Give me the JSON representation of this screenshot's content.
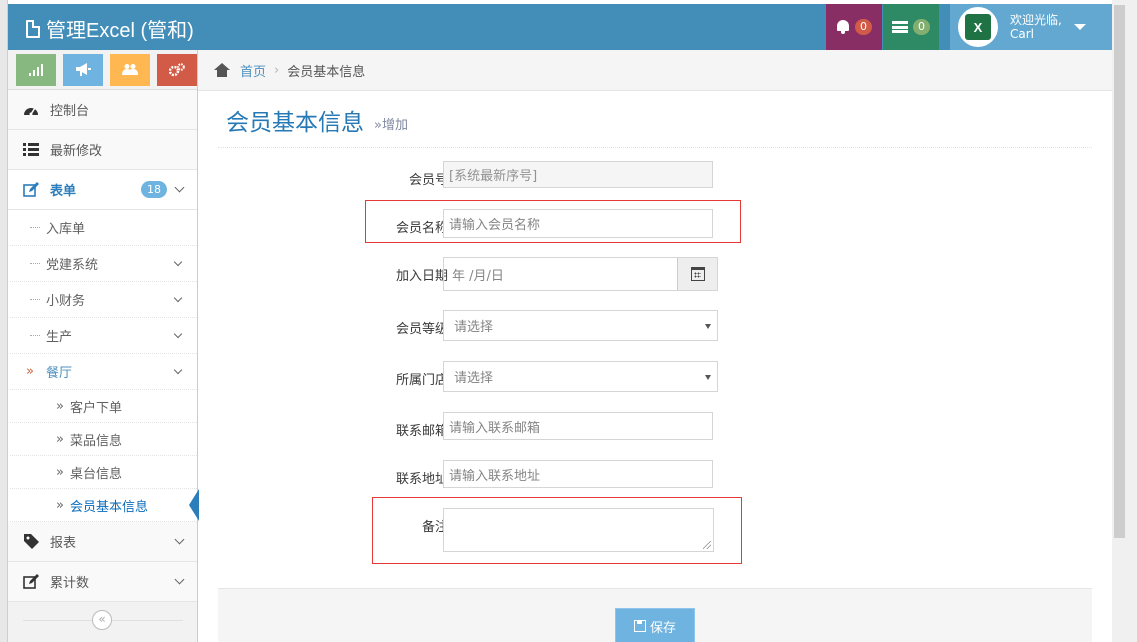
{
  "app": {
    "title": "管理Excel (管和)"
  },
  "navbar": {
    "notifications_count": "0",
    "tasks_count": "0",
    "user_greeting": "欢迎光临,",
    "user_name": "Carl",
    "avatar_label": "X"
  },
  "sidebar": {
    "items": [
      {
        "label": "控制台",
        "icon": "dashboard-icon"
      },
      {
        "label": "最新修改",
        "icon": "list-icon"
      },
      {
        "label": "表单",
        "icon": "edit-icon",
        "badge": "18"
      }
    ],
    "form_sub": [
      "入库单",
      "党建系统",
      "小财务",
      "生产",
      "餐厅"
    ],
    "restaurant_sub": [
      "客户下单",
      "菜品信息",
      "桌台信息",
      "会员基本信息"
    ],
    "bottom_items": [
      {
        "label": "报表",
        "icon": "tag-icon"
      },
      {
        "label": "累计数",
        "icon": "pencil-square-icon"
      }
    ],
    "collapse_label": "«"
  },
  "breadcrumb": {
    "home": "首页",
    "current": "会员基本信息"
  },
  "page": {
    "title": "会员基本信息",
    "subtitle": "»增加"
  },
  "form": {
    "member_no": {
      "label": "会员号",
      "value": "[系统最新序号]"
    },
    "member_name": {
      "label": "会员名称",
      "placeholder": "请输入会员名称"
    },
    "join_date": {
      "label": "加入日期",
      "placeholder": "年 /月/日"
    },
    "member_level": {
      "label": "会员等级",
      "value": "请选择"
    },
    "store": {
      "label": "所属门店",
      "value": "请选择"
    },
    "email": {
      "label": "联系邮箱",
      "placeholder": "请输入联系邮箱"
    },
    "address": {
      "label": "联系地址",
      "placeholder": "请输入联系地址"
    },
    "remark": {
      "label": "备注"
    },
    "save_label": "保存"
  },
  "colors": {
    "navbar": "#438eb9",
    "accent": "#2679b5",
    "highlight_box": "#e53935"
  }
}
